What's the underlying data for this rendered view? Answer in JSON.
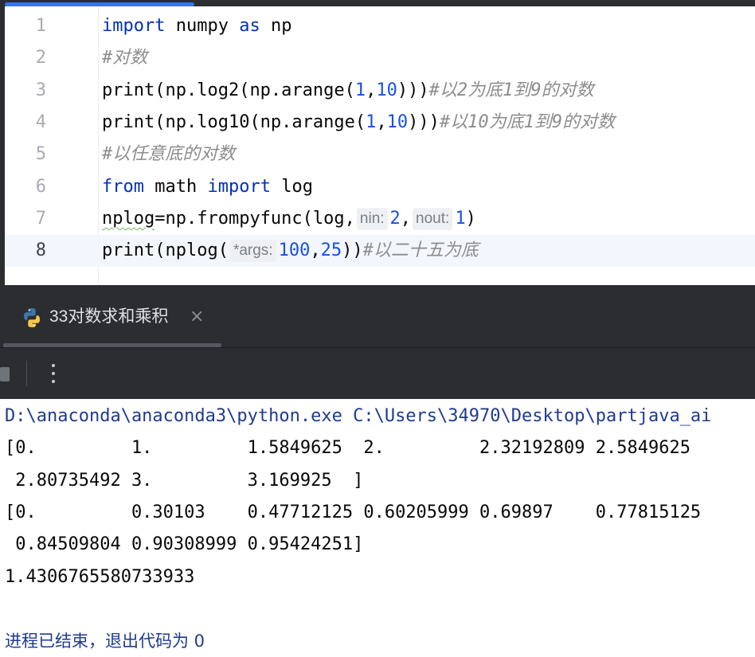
{
  "editor": {
    "lines": [
      {
        "n": "1",
        "parts": [
          {
            "t": "import",
            "c": "kw"
          },
          {
            "t": " numpy "
          },
          {
            "t": "as",
            "c": "kw"
          },
          {
            "t": " np"
          }
        ]
      },
      {
        "n": "2",
        "parts": [
          {
            "t": "#对数",
            "c": "cm"
          }
        ]
      },
      {
        "n": "3",
        "parts": [
          {
            "t": "print"
          },
          {
            "t": "(np.log2(np.arange("
          },
          {
            "t": "1",
            "c": "num"
          },
          {
            "t": ","
          },
          {
            "t": "10",
            "c": "num"
          },
          {
            "t": ")))"
          },
          {
            "t": "#以2为底1到9的对数",
            "c": "cm"
          }
        ]
      },
      {
        "n": "4",
        "parts": [
          {
            "t": "print"
          },
          {
            "t": "(np.log10(np.arange("
          },
          {
            "t": "1",
            "c": "num"
          },
          {
            "t": ","
          },
          {
            "t": "10",
            "c": "num"
          },
          {
            "t": ")))"
          },
          {
            "t": "#以10为底1到9的对数",
            "c": "cm"
          }
        ]
      },
      {
        "n": "5",
        "parts": [
          {
            "t": "#以任意底的对数",
            "c": "cm"
          }
        ]
      },
      {
        "n": "6",
        "parts": [
          {
            "t": "from",
            "c": "kw"
          },
          {
            "t": " math "
          },
          {
            "t": "import",
            "c": "kw"
          },
          {
            "t": " log"
          }
        ]
      },
      {
        "n": "7",
        "parts": [
          {
            "t": "nplog",
            "c": "squig"
          },
          {
            "t": "=np.frompyfunc(log,"
          },
          {
            "t": "nin:",
            "c": "hint"
          },
          {
            "t": "2",
            "c": "num"
          },
          {
            "t": ","
          },
          {
            "t": "nout:",
            "c": "hint"
          },
          {
            "t": "1",
            "c": "num"
          },
          {
            "t": ")"
          }
        ]
      },
      {
        "n": "8",
        "current": true,
        "parts": [
          {
            "t": "print"
          },
          {
            "t": "(nplog("
          },
          {
            "t": "*args:",
            "c": "hint"
          },
          {
            "t": "100",
            "c": "num"
          },
          {
            "t": ","
          },
          {
            "t": "25",
            "c": "num"
          },
          {
            "t": "))"
          },
          {
            "t": "#以二十五为底",
            "c": "cm"
          }
        ]
      }
    ]
  },
  "run_panel": {
    "tab_label": "33对数求和乘积",
    "tab_close": "×",
    "tab_icon": "python-icon"
  },
  "console": {
    "lines": [
      {
        "text": "D:\\anaconda\\anaconda3\\python.exe C:\\Users\\34970\\Desktop\\partjava_ai",
        "kind": "cmd"
      },
      {
        "text": "[0.         1.         1.5849625  2.         2.32192809 2.5849625"
      },
      {
        "text": " 2.80735492 3.         3.169925  ]"
      },
      {
        "text": "[0.         0.30103    0.47712125 0.60205999 0.69897    0.77815125"
      },
      {
        "text": " 0.84509804 0.90308999 0.95424251]"
      },
      {
        "text": "1.4306765580733933"
      },
      {
        "text": ""
      },
      {
        "text": "进程已结束，退出代码为 0",
        "kind": "exit"
      }
    ]
  }
}
